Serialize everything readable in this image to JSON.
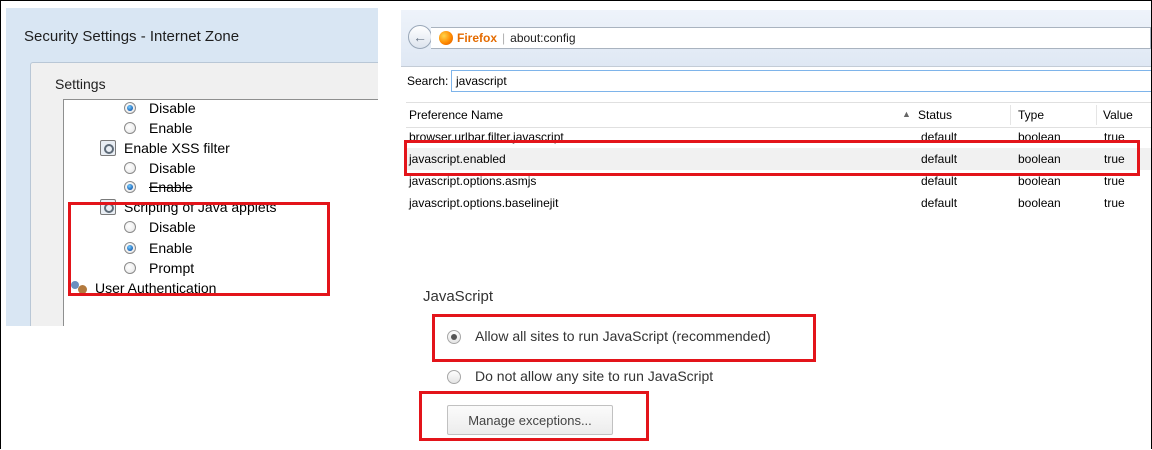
{
  "ie": {
    "title": "Security Settings - Internet Zone",
    "settings_label": "Settings",
    "items": [
      {
        "kind": "radio",
        "label": "Disable",
        "checked": true
      },
      {
        "kind": "radio",
        "label": "Enable",
        "checked": false
      },
      {
        "kind": "group",
        "label": "Enable XSS filter",
        "icon": "settings-gear-icon"
      },
      {
        "kind": "radio",
        "label": "Disable",
        "checked": false
      },
      {
        "kind": "radio",
        "label": "Enable",
        "checked": true
      },
      {
        "kind": "group",
        "label": "Scripting of Java applets",
        "icon": "settings-gear-icon"
      },
      {
        "kind": "radio",
        "label": "Disable",
        "checked": false
      },
      {
        "kind": "radio",
        "label": "Enable",
        "checked": true
      },
      {
        "kind": "radio",
        "label": "Prompt",
        "checked": false
      },
      {
        "kind": "group",
        "label": "User Authentication",
        "icon": "users-icon"
      }
    ]
  },
  "firefox": {
    "brand": "Firefox",
    "address": "about:config",
    "search_label": "Search:",
    "search_value": "javascript",
    "columns": [
      "Preference Name",
      "Status",
      "Type",
      "Value"
    ],
    "rows": [
      {
        "name": "browser.urlbar.filter.javascript",
        "status": "default",
        "type": "boolean",
        "value": "true"
      },
      {
        "name": "javascript.enabled",
        "status": "default",
        "type": "boolean",
        "value": "true"
      },
      {
        "name": "javascript.options.asmjs",
        "status": "default",
        "type": "boolean",
        "value": "true"
      },
      {
        "name": "javascript.options.baselinejit",
        "status": "default",
        "type": "boolean",
        "value": "true"
      }
    ]
  },
  "chrome": {
    "title": "JavaScript",
    "option_allow": "Allow all sites to run JavaScript (recommended)",
    "option_block": "Do not allow any site to run JavaScript",
    "manage_button": "Manage exceptions..."
  },
  "colors": {
    "highlight": "#e3141a",
    "ie_background": "#d9e6f3"
  }
}
